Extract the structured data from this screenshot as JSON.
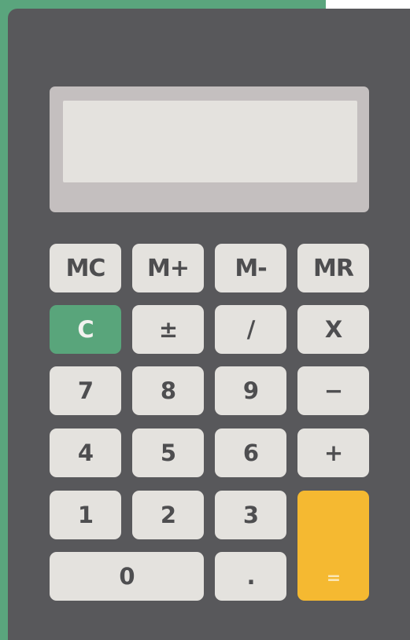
{
  "display": {
    "value": ""
  },
  "colors": {
    "background_accent": "#5aa57d",
    "body": "#58585b",
    "display_frame": "#c4bfbf",
    "display_screen": "#e4e2de",
    "key": "#e4e2de",
    "key_text": "#4e4e50",
    "clear_key": "#59a57b",
    "equals_key": "#f5b931"
  },
  "keys": {
    "mc": "MC",
    "m_plus": "M+",
    "m_minus": "M-",
    "mr": "MR",
    "clear": "C",
    "plus_minus": "±",
    "divide": "/",
    "multiply": "X",
    "seven": "7",
    "eight": "8",
    "nine": "9",
    "subtract": "−",
    "four": "4",
    "five": "5",
    "six": "6",
    "add": "+",
    "one": "1",
    "two": "2",
    "three": "3",
    "equals": "=",
    "zero": "0",
    "decimal": "."
  }
}
